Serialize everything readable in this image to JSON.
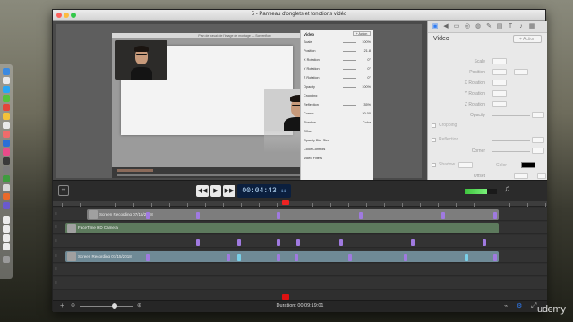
{
  "window": {
    "title": "5 - Panneau d'onglets et fonctions vidéo"
  },
  "inner_app": {
    "title": "Plan de travail de l'image de montage — Screenflow",
    "inspector": {
      "heading": "Video",
      "action": "+ Action",
      "rows": [
        {
          "label": "Scale",
          "value": "100%"
        },
        {
          "label": "Position",
          "value": "21.8"
        },
        {
          "label": "X Rotation",
          "value": "0°"
        },
        {
          "label": "Y Rotation",
          "value": "0°"
        },
        {
          "label": "Z Rotation",
          "value": "0°"
        },
        {
          "label": "Opacity",
          "value": "100%"
        },
        {
          "label": "Cropping",
          "value": ""
        },
        {
          "label": "Reflection",
          "value": "35%"
        },
        {
          "label": "Corner",
          "value": "30.00"
        },
        {
          "label": "Shadow",
          "value": "Color"
        },
        {
          "label": "Offset",
          "value": ""
        },
        {
          "label": "Opacity   Blur Size",
          "value": ""
        },
        {
          "label": "Color Controls",
          "value": ""
        },
        {
          "label": "Video Filters",
          "value": ""
        }
      ]
    }
  },
  "transport": {
    "rewind": "◀◀",
    "play": "▶",
    "forward": "▶▶",
    "timecode": "00:04:43",
    "timecode_frames": "11",
    "level": 0.7
  },
  "timeline": {
    "clips": [
      {
        "track": 1,
        "name": "Screen Recording 07/15/2018"
      },
      {
        "track": 2,
        "name": "FaceTime HD Camera"
      },
      {
        "track": 4,
        "name": "Screen Recording 07/15/2018"
      }
    ],
    "duration_label": "Duration: 00:09:19:01"
  },
  "inspector": {
    "heading": "Video",
    "action": "+ Action",
    "rows": [
      {
        "label": "Scale"
      },
      {
        "label": "Position"
      },
      {
        "label": "X Rotation"
      },
      {
        "label": "Y Rotation"
      },
      {
        "label": "Z Rotation"
      },
      {
        "label": "Opacity"
      },
      {
        "label": "Cropping"
      },
      {
        "label": "Reflection"
      },
      {
        "label": "Corner"
      },
      {
        "label": "Shadow"
      },
      {
        "label": "Offset"
      }
    ],
    "shadow_color_label": "Color"
  },
  "watermark": "udemy"
}
